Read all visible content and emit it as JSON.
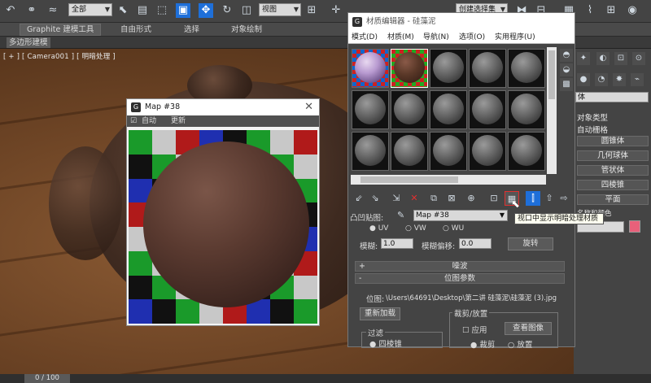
{
  "toolbar": {
    "selection_filter": "全部",
    "ref_coord": "视图",
    "named_selection": "创建选择集"
  },
  "ribbon": {
    "tabs": [
      "Graphite 建模工具",
      "自由形式",
      "选择",
      "对象绘制"
    ],
    "subtab": "多边形建模"
  },
  "viewport": {
    "label": "[ + ] [ Camera001 ] [ 明暗处理 ]"
  },
  "map_window": {
    "title": "Map #38",
    "auto_label": "自动",
    "update_button": "更新"
  },
  "material_editor": {
    "title": "材质编辑器 - 硅藻泥",
    "menu": [
      "模式(D)",
      "材质(M)",
      "导航(N)",
      "选项(O)",
      "实用程序(U)"
    ],
    "map_label": "凸凹贴图:",
    "map_name": "Map #38",
    "uv_labels": [
      "UV",
      "VW",
      "WU"
    ],
    "blur_label": "模糊:",
    "blur_value": "1.0",
    "blur_offset_label": "模糊偏移:",
    "blur_offset_value": "0.0",
    "rotate_button": "旋转",
    "noise_rollout": "噪波",
    "bitmap_rollout": "位图参数",
    "bitmap_label": "位图:",
    "bitmap_path": "\\Users\\64691\\Desktop\\第二讲 硅藻泥\\硅藻泥 (3).jpg",
    "reload_button": "重新加载",
    "crop_group": "裁剪/放置",
    "apply_label": "应用",
    "view_image_button": "查看图像",
    "crop_label": "裁剪",
    "place_label": "放置",
    "filter_group": "过滤",
    "filter_option": "四棱锥"
  },
  "tooltip": {
    "text": "视口中显示明暗处理材质"
  },
  "command_panel": {
    "object_type": "对象类型",
    "autogrid": "自动栅格",
    "buttons": [
      "圆锥体",
      "几何球体",
      "管状体",
      "四棱锥",
      "平面"
    ],
    "name_color": "名称和颜色"
  },
  "timeline": {
    "frame": "0 / 100"
  },
  "colors": {
    "accent_blue": "#1e6fd9",
    "highlight_red": "#e03030"
  }
}
